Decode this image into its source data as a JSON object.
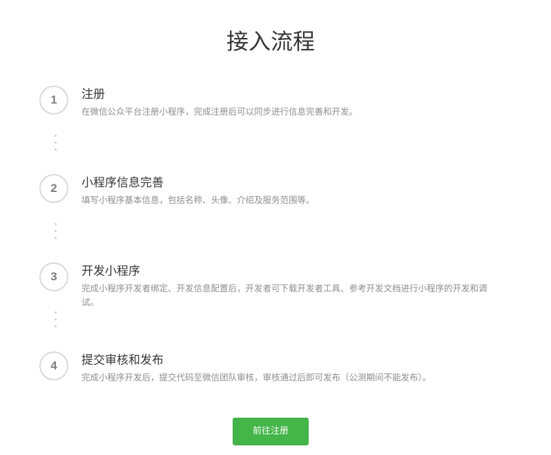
{
  "page": {
    "title": "接入流程"
  },
  "steps": [
    {
      "number": "1",
      "title": "注册",
      "description": "在微信公众平台注册小程序，完成注册后可以同步进行信息完善和开发。"
    },
    {
      "number": "2",
      "title": "小程序信息完善",
      "description": "填写小程序基本信息，包括名称、头像、介绍及服务范围等。"
    },
    {
      "number": "3",
      "title": "开发小程序",
      "description": "完成小程序开发者绑定、开发信息配置后，开发者可下载开发者工具、参考开发文档进行小程序的开发和调试。"
    },
    {
      "number": "4",
      "title": "提交审核和发布",
      "description": "完成小程序开发后，提交代码至微信团队审核，审核通过后即可发布（公测期间不能发布）。"
    }
  ],
  "action": {
    "register_label": "前往注册"
  },
  "colors": {
    "button": "#44b549",
    "circle_border": "#d9d9d9",
    "description_text": "#8d8d8d"
  }
}
